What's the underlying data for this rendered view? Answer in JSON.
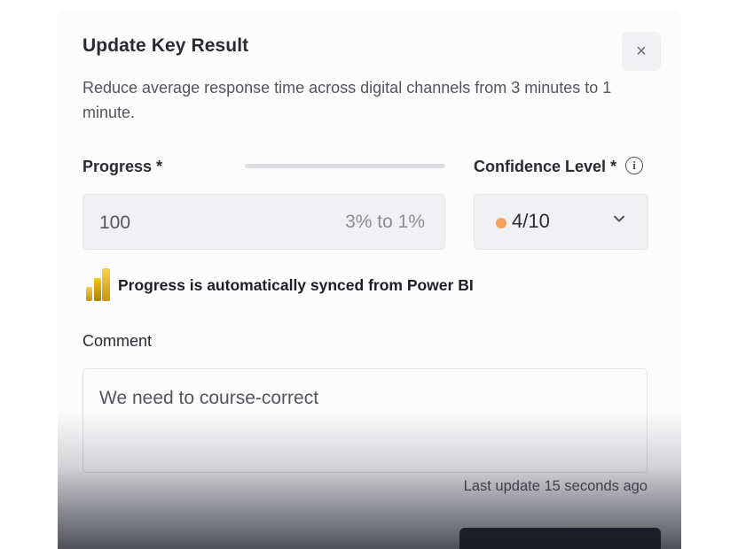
{
  "dialog": {
    "title": "Update Key Result",
    "close_glyph": "×",
    "description": "Reduce average response time across digital channels from 3 minutes to 1 minute."
  },
  "progress": {
    "label": "Progress *",
    "value": "100",
    "range_hint": "3% to 1%",
    "bar_fraction": 0.0
  },
  "confidence": {
    "label": "Confidence Level *",
    "info_glyph": "i",
    "value": "4/10",
    "dot_color": "#f4a060"
  },
  "sync_notice": {
    "icon": "power-bi-icon",
    "text": "Progress is automatically synced from Power BI"
  },
  "comment": {
    "label": "Comment",
    "value": "We need to course-correct"
  },
  "footer": {
    "last_update": "Last update 15 seconds ago"
  },
  "colors": {
    "accent_dark": "#2a2c37",
    "pbi_yellow": "#f2c811"
  }
}
